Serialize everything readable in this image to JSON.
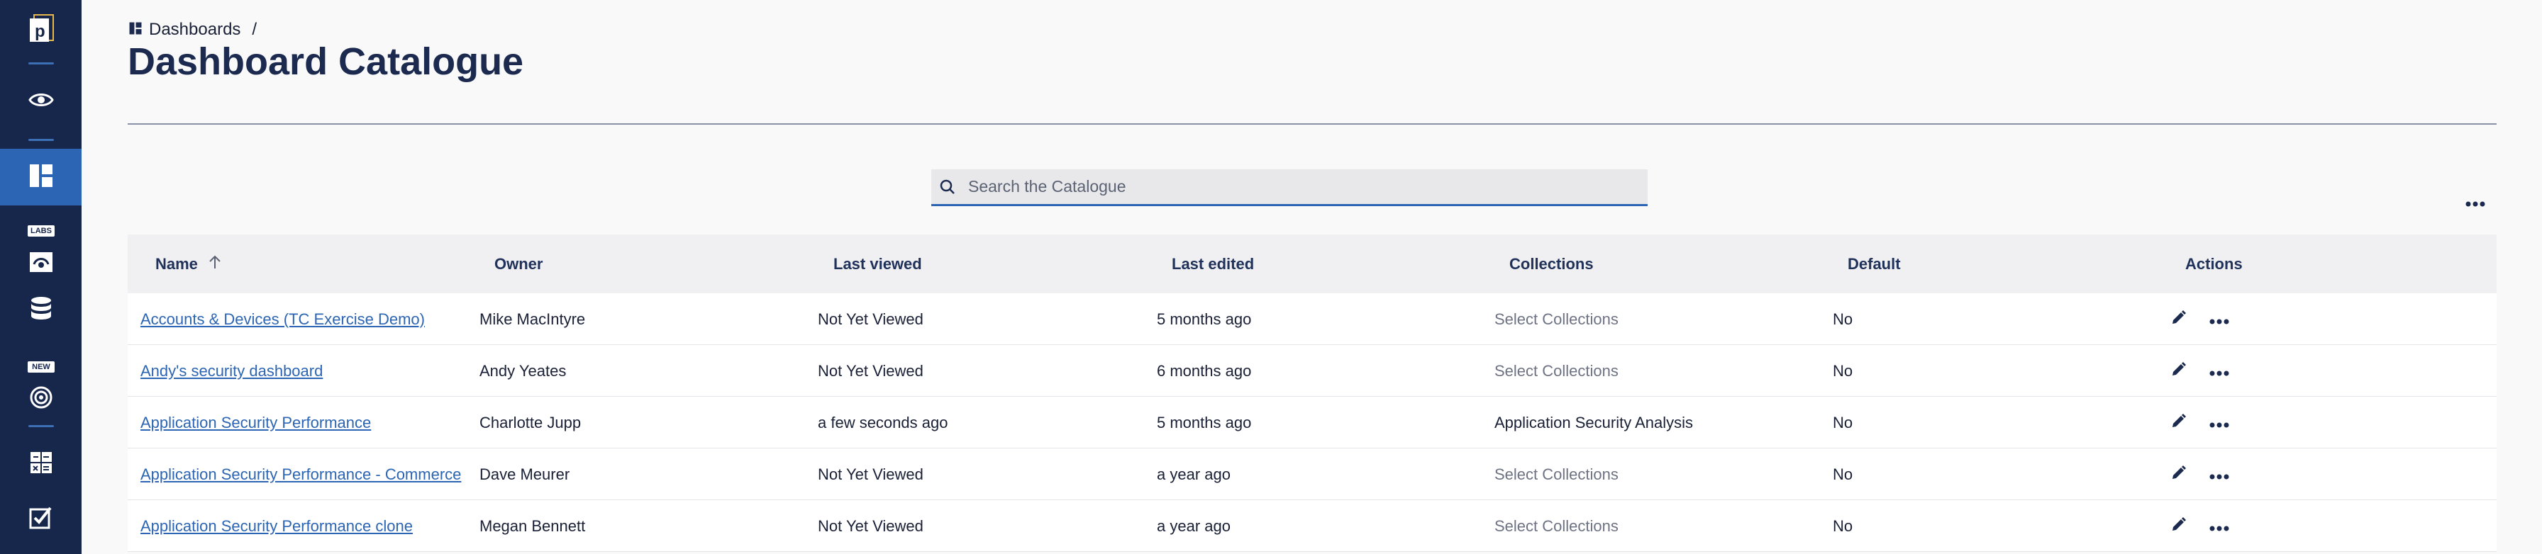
{
  "sidebar": {
    "items": [
      {
        "name": "pendo-logo",
        "icon": "logo-icon"
      },
      {
        "name": "eye",
        "icon": "eye-icon"
      },
      {
        "name": "dashboards",
        "icon": "dashboard-icon",
        "active": true
      },
      {
        "name": "labs",
        "icon": "labs-icon",
        "badge": "LABS"
      },
      {
        "name": "data",
        "icon": "database-icon"
      },
      {
        "name": "target",
        "icon": "target-icon",
        "badge": "NEW"
      },
      {
        "name": "calculator",
        "icon": "calculator-icon"
      },
      {
        "name": "checklist",
        "icon": "checkbox-icon"
      }
    ]
  },
  "breadcrumb": {
    "label": "Dashboards",
    "separator": "/"
  },
  "page": {
    "title": "Dashboard Catalogue"
  },
  "search": {
    "placeholder": "Search the Catalogue",
    "value": ""
  },
  "table": {
    "headers": {
      "name": "Name",
      "owner": "Owner",
      "last_viewed": "Last viewed",
      "last_edited": "Last edited",
      "collections": "Collections",
      "default": "Default",
      "actions": "Actions"
    },
    "rows": [
      {
        "name": "Accounts & Devices (TC Exercise Demo)",
        "owner": "Mike MacIntyre",
        "last_viewed": "Not Yet Viewed",
        "last_edited": "5 months ago",
        "collections": "Select Collections",
        "collections_placeholder": true,
        "default": "No"
      },
      {
        "name": "Andy's security dashboard",
        "owner": "Andy Yeates",
        "last_viewed": "Not Yet Viewed",
        "last_edited": "6 months ago",
        "collections": "Select Collections",
        "collections_placeholder": true,
        "default": "No"
      },
      {
        "name": "Application Security Performance",
        "owner": "Charlotte Jupp",
        "last_viewed": "a few seconds ago",
        "last_edited": "5 months ago",
        "collections": "Application Security Analysis",
        "collections_placeholder": false,
        "default": "No"
      },
      {
        "name": "Application Security Performance - Commerce",
        "owner": "Dave Meurer",
        "last_viewed": "Not Yet Viewed",
        "last_edited": "a year ago",
        "collections": "Select Collections",
        "collections_placeholder": true,
        "default": "No"
      },
      {
        "name": "Application Security Performance clone",
        "owner": "Megan Bennett",
        "last_viewed": "Not Yet Viewed",
        "last_edited": "a year ago",
        "collections": "Select Collections",
        "collections_placeholder": true,
        "default": "No"
      }
    ]
  },
  "colors": {
    "sidebar": "#17264b",
    "accent": "#2c65b3",
    "title": "#1b2a4e"
  }
}
